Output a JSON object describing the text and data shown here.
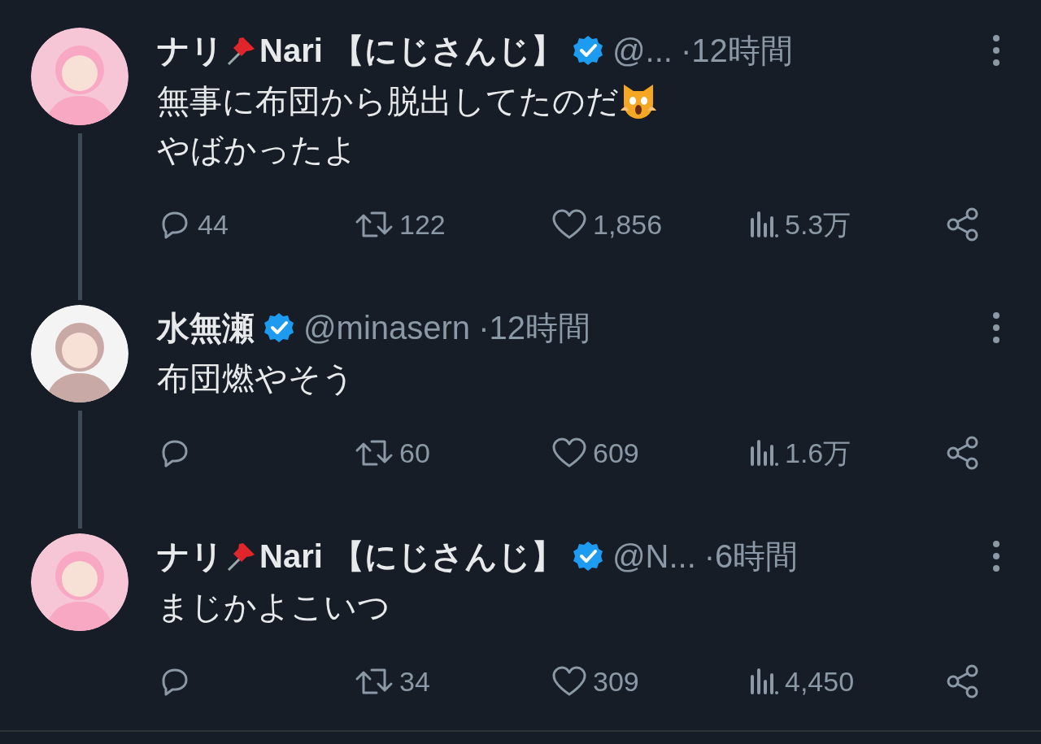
{
  "tweets": [
    {
      "name_before": "ナリ",
      "pin_icon": true,
      "name_after": "Nari 【にじさんじ】",
      "verified": true,
      "handle": "@...",
      "time": "·12時間",
      "lines": [
        {
          "text": "無事に布団から脱出してたのだ",
          "cat_icon": true
        },
        {
          "text": "やばかったよ",
          "cat_icon": false
        }
      ],
      "replies": "44",
      "retweets": "122",
      "likes": "1,856",
      "views": "5.3万",
      "thread_continues": true
    },
    {
      "name_before": "水無瀬",
      "pin_icon": false,
      "verified": true,
      "handle": "@minasern",
      "time": "·12時間",
      "lines": [
        {
          "text": "布団燃やそう",
          "cat_icon": false
        }
      ],
      "retweets": "60",
      "likes": "609",
      "views": "1.6万",
      "thread_continues": true
    },
    {
      "name_before": "ナリ",
      "pin_icon": true,
      "name_after": "Nari 【にじさんじ】",
      "verified": true,
      "handle": "@N...",
      "time": "·6時間",
      "lines": [
        {
          "text": "まじかよこいつ",
          "cat_icon": false
        }
      ],
      "retweets": "34",
      "likes": "309",
      "views": "4,450",
      "thread_continues": false
    }
  ]
}
